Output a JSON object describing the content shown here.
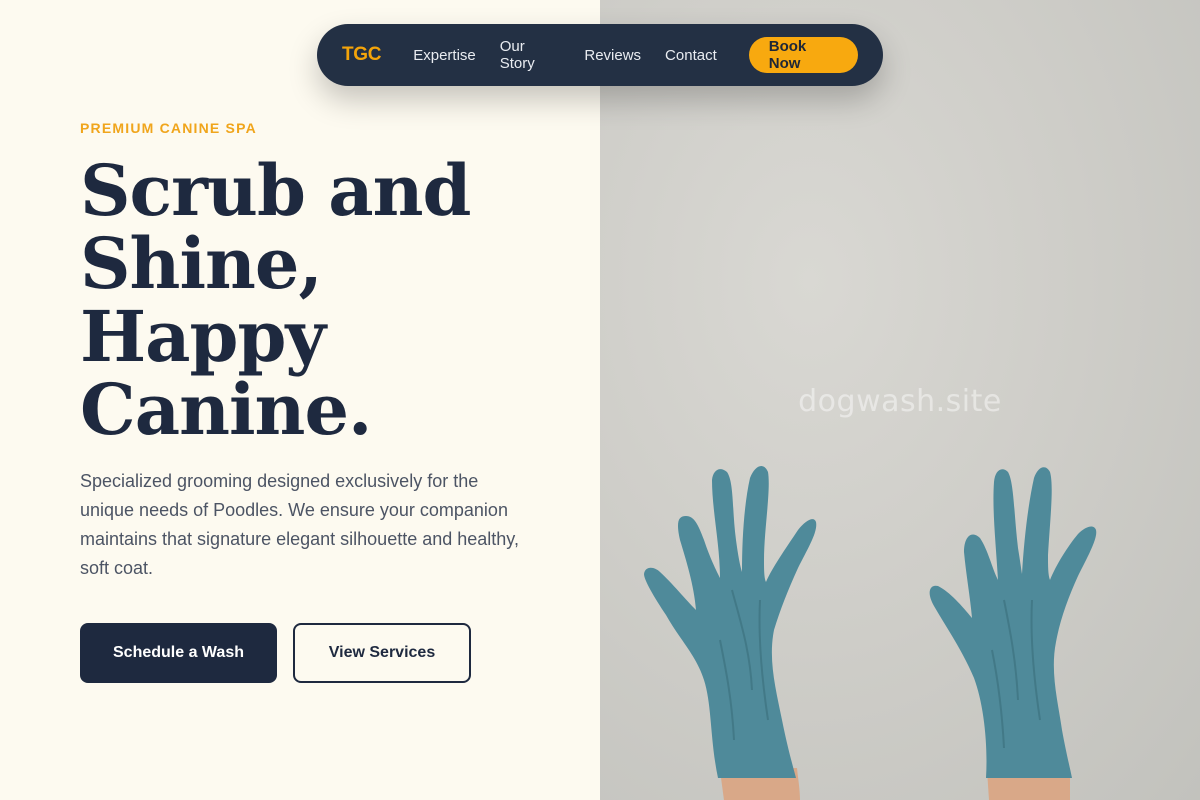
{
  "nav": {
    "logo": "TGC",
    "links": [
      "Expertise",
      "Our Story",
      "Reviews",
      "Contact"
    ],
    "cta": "Book Now"
  },
  "hero": {
    "eyebrow": "PREMIUM CANINE SPA",
    "headline_lines": [
      "Scrub and",
      "Shine,",
      "Happy",
      "Canine."
    ],
    "description": "Specialized grooming designed exclusively for the unique needs of Poodles. We ensure your companion maintains that signature elegant silhouette and healthy, soft coat.",
    "primary_button": "Schedule a Wash",
    "secondary_button": "View Services"
  },
  "image": {
    "watermark": "dogwash.site",
    "subject": "raised-hands-in-blue-gloves"
  },
  "colors": {
    "accent": "#f8a90f",
    "navy": "#1e293f",
    "cream": "#fdfaf0",
    "glove": "#4f8a9a"
  }
}
